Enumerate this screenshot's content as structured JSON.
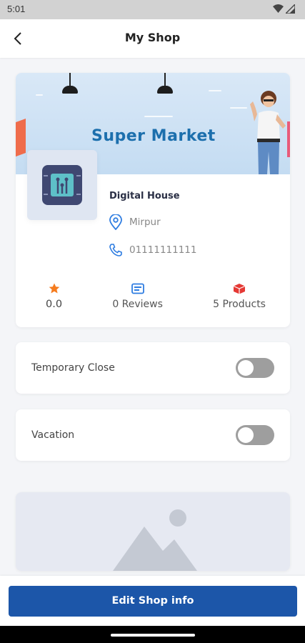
{
  "status_bar": {
    "time": "5:01",
    "icons": [
      "wifi-icon",
      "signal-icon"
    ]
  },
  "app_bar": {
    "title": "My Shop",
    "back_icon": "arrow-left-icon"
  },
  "shop": {
    "banner_text": "Super Market",
    "name": "Digital House",
    "location": "Mirpur",
    "phone": "01111111111"
  },
  "stats": [
    {
      "icon": "star-icon",
      "value": "0.0",
      "color": "#f57c1f"
    },
    {
      "icon": "review-icon",
      "value": "0 Reviews",
      "color": "#2f7de1"
    },
    {
      "icon": "box-icon",
      "value": "5 Products",
      "color": "#e53935"
    }
  ],
  "toggles": {
    "temporary_close": {
      "label": "Temporary Close",
      "on": false
    },
    "vacation": {
      "label": "Vacation",
      "on": false
    }
  },
  "actions": {
    "edit_label": "Edit Shop info"
  },
  "colors": {
    "primary": "#1c56a9",
    "accent_blue": "#1c6fad",
    "icon_blue": "#2f7de1"
  }
}
